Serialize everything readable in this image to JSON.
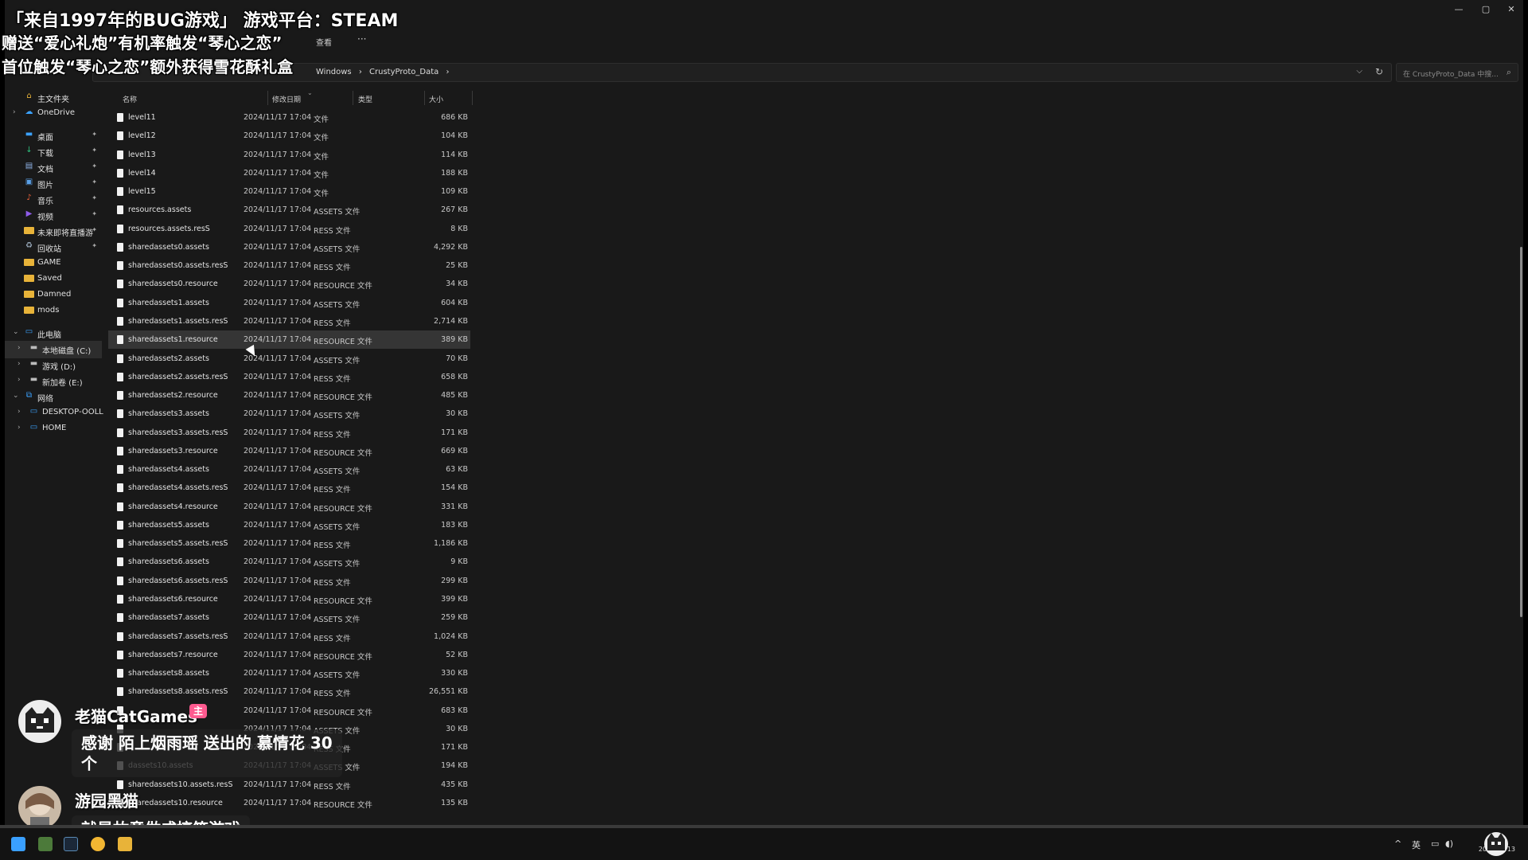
{
  "window": {
    "controls": {
      "minimize": "—",
      "maximize": "▢",
      "close": "✕"
    }
  },
  "toolbar": {
    "view_label": "查看",
    "more_label": "···"
  },
  "address": {
    "breadcrumb": [
      "Windows",
      "CrustyProto_Data"
    ],
    "separator": "›",
    "dropdown_icon": "chevron-down",
    "refresh_icon": "refresh"
  },
  "search": {
    "placeholder": "在 CrustyProto_Data 中搜..."
  },
  "nav": {
    "items": [
      {
        "label": "主文件夹",
        "icon": "home-icon",
        "pinned": false,
        "chevron": false,
        "indent": 0
      },
      {
        "label": "OneDrive",
        "icon": "cloud-icon",
        "pinned": false,
        "chevron": true,
        "indent": 0
      },
      {
        "label": "桌面",
        "icon": "desktop-icon",
        "pinned": true,
        "chevron": false,
        "indent": 0
      },
      {
        "label": "下载",
        "icon": "download-icon",
        "pinned": true,
        "chevron": false,
        "indent": 0
      },
      {
        "label": "文档",
        "icon": "document-icon",
        "pinned": true,
        "chevron": false,
        "indent": 0
      },
      {
        "label": "图片",
        "icon": "picture-icon",
        "pinned": true,
        "chevron": false,
        "indent": 0
      },
      {
        "label": "音乐",
        "icon": "music-icon",
        "pinned": true,
        "chevron": false,
        "indent": 0
      },
      {
        "label": "视频",
        "icon": "video-icon",
        "pinned": true,
        "chevron": false,
        "indent": 0
      },
      {
        "label": "未来即将直播游",
        "icon": "folder-icon",
        "pinned": true,
        "chevron": false,
        "indent": 0
      },
      {
        "label": "回收站",
        "icon": "recycle-bin-icon",
        "pinned": true,
        "chevron": false,
        "indent": 0
      },
      {
        "label": "GAME",
        "icon": "folder-icon",
        "pinned": false,
        "chevron": false,
        "indent": 0
      },
      {
        "label": "Saved",
        "icon": "folder-icon",
        "pinned": false,
        "chevron": false,
        "indent": 0
      },
      {
        "label": "Damned",
        "icon": "folder-icon",
        "pinned": false,
        "chevron": false,
        "indent": 0
      },
      {
        "label": "mods",
        "icon": "folder-icon",
        "pinned": false,
        "chevron": false,
        "indent": 0
      },
      {
        "label": "此电脑",
        "icon": "pc-icon",
        "pinned": false,
        "chevron": true,
        "expanded": true,
        "indent": 0
      },
      {
        "label": "本地磁盘 (C:)",
        "icon": "drive-icon",
        "pinned": false,
        "chevron": true,
        "indent": 1,
        "active": true
      },
      {
        "label": "游戏 (D:)",
        "icon": "drive-icon",
        "pinned": false,
        "chevron": true,
        "indent": 1
      },
      {
        "label": "新加卷 (E:)",
        "icon": "drive-icon",
        "pinned": false,
        "chevron": true,
        "indent": 1
      },
      {
        "label": "网络",
        "icon": "network-icon",
        "pinned": false,
        "chevron": true,
        "expanded": true,
        "indent": 0
      },
      {
        "label": "DESKTOP-OOLL",
        "icon": "monitor-icon",
        "pinned": false,
        "chevron": true,
        "indent": 1
      },
      {
        "label": "HOME",
        "icon": "monitor-icon",
        "pinned": false,
        "chevron": true,
        "indent": 1
      }
    ]
  },
  "columns": {
    "name": "名称",
    "date": "修改日期",
    "type": "类型",
    "size": "大小"
  },
  "files": [
    {
      "name": "level11",
      "date": "2024/11/17 17:04",
      "type": "文件",
      "size": "686 KB"
    },
    {
      "name": "level12",
      "date": "2024/11/17 17:04",
      "type": "文件",
      "size": "104 KB"
    },
    {
      "name": "level13",
      "date": "2024/11/17 17:04",
      "type": "文件",
      "size": "114 KB"
    },
    {
      "name": "level14",
      "date": "2024/11/17 17:04",
      "type": "文件",
      "size": "188 KB"
    },
    {
      "name": "level15",
      "date": "2024/11/17 17:04",
      "type": "文件",
      "size": "109 KB"
    },
    {
      "name": "resources.assets",
      "date": "2024/11/17 17:04",
      "type": "ASSETS 文件",
      "size": "267 KB"
    },
    {
      "name": "resources.assets.resS",
      "date": "2024/11/17 17:04",
      "type": "RESS 文件",
      "size": "8 KB"
    },
    {
      "name": "sharedassets0.assets",
      "date": "2024/11/17 17:04",
      "type": "ASSETS 文件",
      "size": "4,292 KB"
    },
    {
      "name": "sharedassets0.assets.resS",
      "date": "2024/11/17 17:04",
      "type": "RESS 文件",
      "size": "25 KB"
    },
    {
      "name": "sharedassets0.resource",
      "date": "2024/11/17 17:04",
      "type": "RESOURCE 文件",
      "size": "34 KB"
    },
    {
      "name": "sharedassets1.assets",
      "date": "2024/11/17 17:04",
      "type": "ASSETS 文件",
      "size": "604 KB"
    },
    {
      "name": "sharedassets1.assets.resS",
      "date": "2024/11/17 17:04",
      "type": "RESS 文件",
      "size": "2,714 KB"
    },
    {
      "name": "sharedassets1.resource",
      "date": "2024/11/17 17:04",
      "type": "RESOURCE 文件",
      "size": "389 KB",
      "hover": true
    },
    {
      "name": "sharedassets2.assets",
      "date": "2024/11/17 17:04",
      "type": "ASSETS 文件",
      "size": "70 KB"
    },
    {
      "name": "sharedassets2.assets.resS",
      "date": "2024/11/17 17:04",
      "type": "RESS 文件",
      "size": "658 KB"
    },
    {
      "name": "sharedassets2.resource",
      "date": "2024/11/17 17:04",
      "type": "RESOURCE 文件",
      "size": "485 KB"
    },
    {
      "name": "sharedassets3.assets",
      "date": "2024/11/17 17:04",
      "type": "ASSETS 文件",
      "size": "30 KB"
    },
    {
      "name": "sharedassets3.assets.resS",
      "date": "2024/11/17 17:04",
      "type": "RESS 文件",
      "size": "171 KB"
    },
    {
      "name": "sharedassets3.resource",
      "date": "2024/11/17 17:04",
      "type": "RESOURCE 文件",
      "size": "669 KB"
    },
    {
      "name": "sharedassets4.assets",
      "date": "2024/11/17 17:04",
      "type": "ASSETS 文件",
      "size": "63 KB"
    },
    {
      "name": "sharedassets4.assets.resS",
      "date": "2024/11/17 17:04",
      "type": "RESS 文件",
      "size": "154 KB"
    },
    {
      "name": "sharedassets4.resource",
      "date": "2024/11/17 17:04",
      "type": "RESOURCE 文件",
      "size": "331 KB"
    },
    {
      "name": "sharedassets5.assets",
      "date": "2024/11/17 17:04",
      "type": "ASSETS 文件",
      "size": "183 KB"
    },
    {
      "name": "sharedassets5.assets.resS",
      "date": "2024/11/17 17:04",
      "type": "RESS 文件",
      "size": "1,186 KB"
    },
    {
      "name": "sharedassets6.assets",
      "date": "2024/11/17 17:04",
      "type": "ASSETS 文件",
      "size": "9 KB"
    },
    {
      "name": "sharedassets6.assets.resS",
      "date": "2024/11/17 17:04",
      "type": "RESS 文件",
      "size": "299 KB"
    },
    {
      "name": "sharedassets6.resource",
      "date": "2024/11/17 17:04",
      "type": "RESOURCE 文件",
      "size": "399 KB"
    },
    {
      "name": "sharedassets7.assets",
      "date": "2024/11/17 17:04",
      "type": "ASSETS 文件",
      "size": "259 KB"
    },
    {
      "name": "sharedassets7.assets.resS",
      "date": "2024/11/17 17:04",
      "type": "RESS 文件",
      "size": "1,024 KB"
    },
    {
      "name": "sharedassets7.resource",
      "date": "2024/11/17 17:04",
      "type": "RESOURCE 文件",
      "size": "52 KB"
    },
    {
      "name": "sharedassets8.assets",
      "date": "2024/11/17 17:04",
      "type": "ASSETS 文件",
      "size": "330 KB"
    },
    {
      "name": "sharedassets8.assets.resS",
      "date": "2024/11/17 17:04",
      "type": "RESS 文件",
      "size": "26,551 KB"
    },
    {
      "name": "",
      "date": "2024/11/17 17:04",
      "type": "RESOURCE 文件",
      "size": "683 KB"
    },
    {
      "name": "",
      "date": "2024/11/17 17:04",
      "type": "ASSETS 文件",
      "size": "30 KB"
    },
    {
      "name": "",
      "date": "2024/11/17 17:04",
      "type": "RESS 文件",
      "size": "171 KB"
    },
    {
      "name": "dassets10.assets",
      "date": "2024/11/17 17:04",
      "type": "ASSETS 文件",
      "size": "194 KB"
    },
    {
      "name": "sharedassets10.assets.resS",
      "date": "2024/11/17 17:04",
      "type": "RESS 文件",
      "size": "435 KB"
    },
    {
      "name": "sharedassets10.resource",
      "date": "2024/11/17 17:04",
      "type": "RESOURCE 文件",
      "size": "135 KB"
    }
  ],
  "overlay": {
    "line1": "「来自1997年的BUG游戏」 游戏平台：STEAM",
    "line2": "赠送“爱心礼炮”有机率触发“琴心之恋”",
    "line3": "首位触发“琴心之恋”额外获得雪花酥礼盒",
    "streamer_name": "老猫CatGames",
    "host_badge": "主",
    "gift_message": "感谢 陌上烟雨瑶 送出的 慕情花 30个",
    "viewer_name": "游园黑猫",
    "viewer_message": "就是故意做成搞笑游戏"
  },
  "taskbar": {
    "tray_expand": "^",
    "ime": "英",
    "date": "2024/12/13"
  }
}
